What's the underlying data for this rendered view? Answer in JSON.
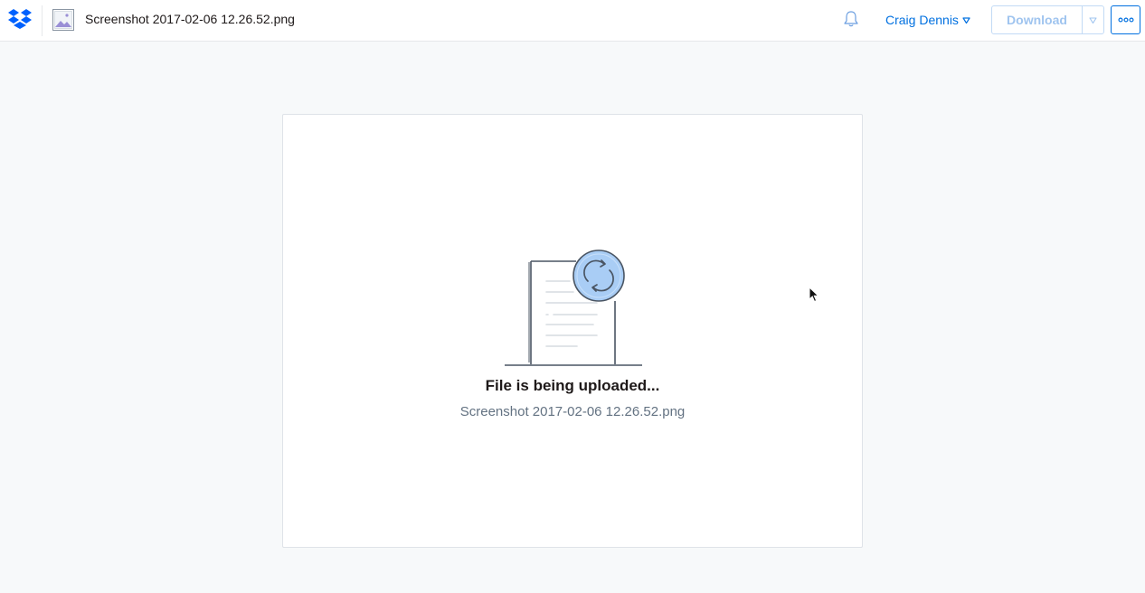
{
  "header": {
    "file_name": "Screenshot 2017-02-06 12.26.52.png",
    "user_name": "Craig Dennis",
    "download_label": "Download",
    "icons": [
      "dropbox-logo-icon",
      "image-file-icon",
      "bell-icon",
      "chevron-down-icon",
      "more-options-icon"
    ]
  },
  "main": {
    "status_title": "File is being uploaded...",
    "status_file_name": "Screenshot 2017-02-06 12.26.52.png",
    "icons": [
      "upload-sync-icon"
    ]
  },
  "colors": {
    "accent": "#0070e0",
    "disabled_button_text": "#9fc4ef",
    "sync_circle": "#a9cdf5",
    "background": "#f7f9fa"
  }
}
